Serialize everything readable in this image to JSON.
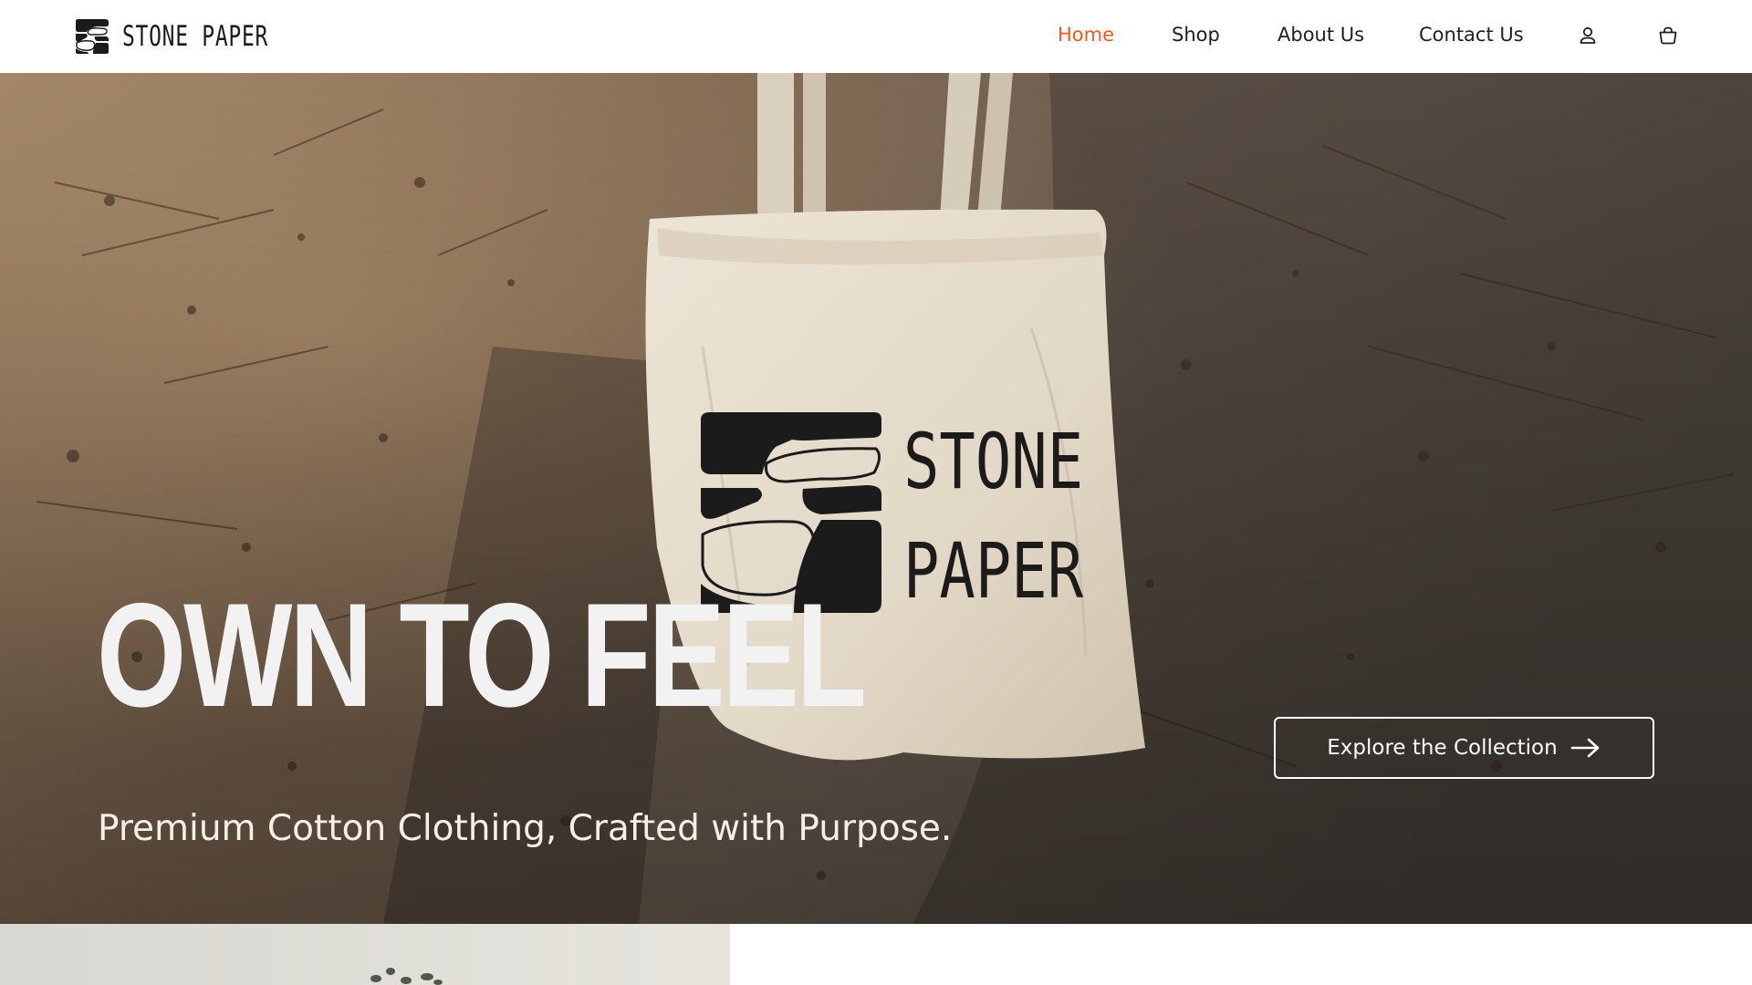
{
  "brand": {
    "name": "STONE PAPER",
    "logo_icon": "stone-paper-logo-icon"
  },
  "nav": {
    "items": [
      {
        "label": "Home",
        "active": true
      },
      {
        "label": "Shop",
        "active": false
      },
      {
        "label": "About Us",
        "active": false
      },
      {
        "label": "Contact Us",
        "active": false
      }
    ],
    "account_icon": "user-icon",
    "cart_icon": "shopping-bag-icon"
  },
  "hero": {
    "title": "OWN TO FEEL",
    "subtitle": "Premium Cotton Clothing, Crafted with Purpose.",
    "cta_label": "Explore the Collection",
    "cta_icon": "arrow-right-icon",
    "background": "photo of a cream cotton tote bag printed with the Stone Paper logo lying on textured rock"
  },
  "colors": {
    "accent": "#ef5a23",
    "text_dark": "#1f1f1f",
    "hero_text": "#f2f2f2"
  }
}
